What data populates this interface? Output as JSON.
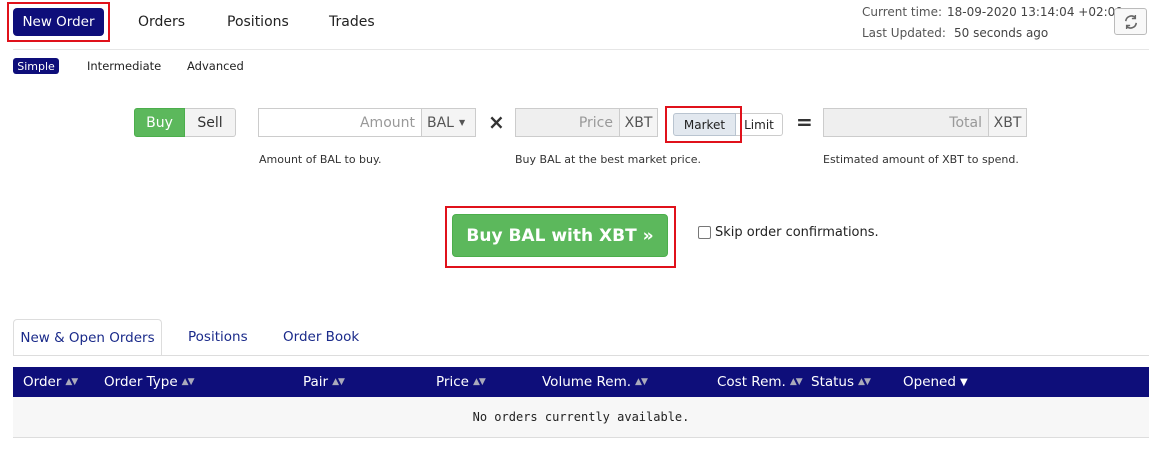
{
  "nav": {
    "items": [
      "New Order",
      "Orders",
      "Positions",
      "Trades"
    ]
  },
  "status": {
    "current_time_label": "Current time:",
    "current_time_value": "18-09-2020 13:14:04 +02:00",
    "last_updated_label": "Last Updated:",
    "last_updated_value": "50 seconds ago"
  },
  "modes": [
    "Simple",
    "Intermediate",
    "Advanced"
  ],
  "form": {
    "buy_label": "Buy",
    "sell_label": "Sell",
    "amount_placeholder": "Amount",
    "amount_currency": "BAL",
    "multiply": "×",
    "price_placeholder": "Price",
    "price_currency": "XBT",
    "market_label": "Market",
    "limit_label": "Limit",
    "equals": "=",
    "total_placeholder": "Total",
    "total_currency": "XBT",
    "amount_help": "Amount of BAL to buy.",
    "price_help": "Buy BAL at the best market price.",
    "total_help": "Estimated amount of XBT to spend.",
    "submit_label": "Buy BAL with XBT »",
    "skip_label": "Skip order confirmations."
  },
  "tabs": [
    "New & Open Orders",
    "Positions",
    "Order Book"
  ],
  "table": {
    "columns": [
      "Order",
      "Order Type",
      "Pair",
      "Price",
      "Volume Rem.",
      "Cost Rem.",
      "Status",
      "Opened"
    ],
    "empty_message": "No orders currently available."
  },
  "icons": {
    "refresh": "refresh-icon",
    "dropdown": "caret-down-icon"
  },
  "colors": {
    "brand": "#0e0e7a",
    "buy": "#5cb85c",
    "highlight": "#e0111b"
  }
}
